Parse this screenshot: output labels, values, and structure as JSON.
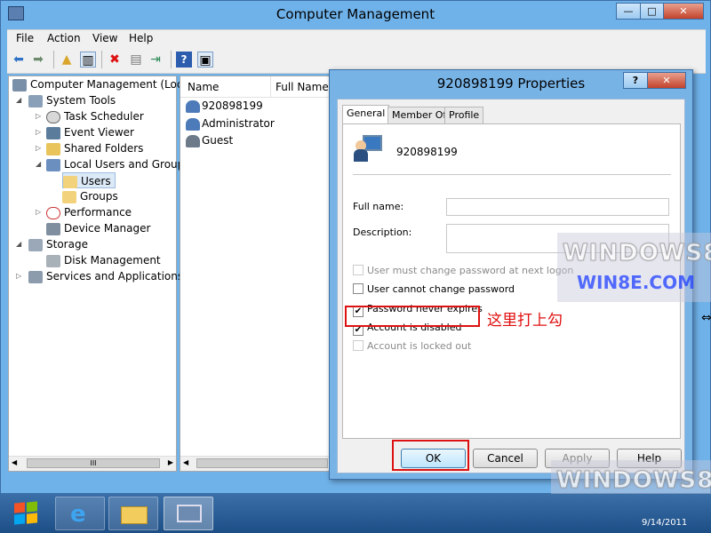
{
  "main_window": {
    "title": "Computer Management",
    "buttons": {
      "minimize": "—",
      "maximize": "□",
      "close": "✕"
    }
  },
  "menu": [
    "File",
    "Action",
    "View",
    "Help"
  ],
  "toolbar": {
    "icons": [
      "back-icon",
      "forward-icon",
      "up-icon",
      "show-hide-tree-icon",
      "delete-icon",
      "properties-icon",
      "export-icon",
      "help-icon",
      "console-icon"
    ]
  },
  "tree": {
    "items": [
      {
        "label": "Computer Management (Local",
        "icon": "computer-management-icon"
      },
      {
        "label": "System Tools",
        "icon": "system-tools-icon"
      },
      {
        "label": "Task Scheduler",
        "icon": "clock-icon"
      },
      {
        "label": "Event Viewer",
        "icon": "event-viewer-icon"
      },
      {
        "label": "Shared Folders",
        "icon": "shared-folder-icon"
      },
      {
        "label": "Local Users and Groups",
        "icon": "users-groups-icon"
      },
      {
        "label": "Users",
        "icon": "folder-icon"
      },
      {
        "label": "Groups",
        "icon": "folder-icon"
      },
      {
        "label": "Performance",
        "icon": "performance-icon"
      },
      {
        "label": "Device Manager",
        "icon": "device-manager-icon"
      },
      {
        "label": "Storage",
        "icon": "storage-icon"
      },
      {
        "label": "Disk Management",
        "icon": "disk-icon"
      },
      {
        "label": "Services and Applications",
        "icon": "services-icon"
      }
    ],
    "scroll_label": "III"
  },
  "list": {
    "columns": [
      "Name",
      "Full Name"
    ],
    "rows": [
      {
        "name": "920898199",
        "icon": "user-icon"
      },
      {
        "name": "Administrator",
        "icon": "user-icon"
      },
      {
        "name": "Guest",
        "icon": "user-disabled-icon"
      }
    ]
  },
  "dialog": {
    "title": "920898199 Properties",
    "help_button": "?",
    "close_button": "✕",
    "tabs": [
      "General",
      "Member Of",
      "Profile"
    ],
    "active_tab": "General",
    "username": "920898199",
    "full_name_label": "Full name:",
    "full_name_value": "",
    "description_label": "Description:",
    "description_value": "",
    "checkboxes": [
      {
        "label": "User must change password at next logon",
        "checked": false,
        "enabled": false
      },
      {
        "label": "User cannot change password",
        "checked": false,
        "enabled": true
      },
      {
        "label": "Password never expires",
        "checked": true,
        "enabled": true
      },
      {
        "label": "Account is disabled",
        "checked": true,
        "enabled": true
      },
      {
        "label": "Account is locked out",
        "checked": false,
        "enabled": false
      }
    ],
    "buttons": {
      "ok": "OK",
      "cancel": "Cancel",
      "apply": "Apply",
      "help": "Help"
    }
  },
  "annotation": "这里打上勾",
  "watermarks": {
    "big": "WINDOWS8",
    "small": "WIN8E.COM"
  },
  "taskbar": {
    "items": [
      "start-orb-icon",
      "internet-explorer-icon",
      "file-explorer-icon",
      "computer-management-icon"
    ],
    "clock": "9/14/2011"
  },
  "colors": {
    "annotation": "#e01010",
    "watermark_blue": "#2040ff",
    "taskbar": "#2a5e98"
  }
}
